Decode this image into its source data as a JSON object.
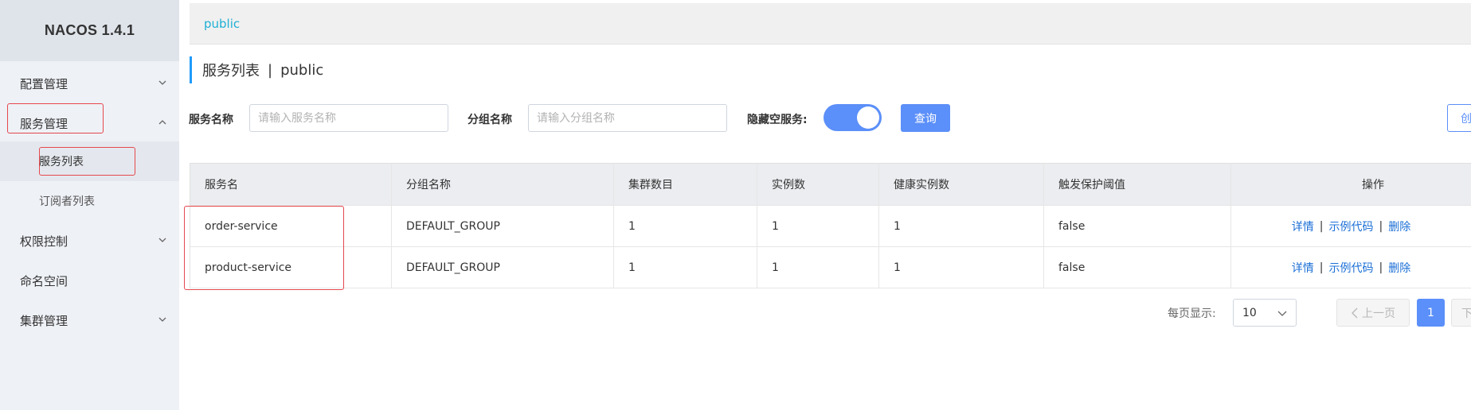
{
  "app": {
    "title": "NACOS 1.4.1"
  },
  "sidebar": {
    "items": [
      {
        "label": "配置管理",
        "icon": "chevron-down-icon"
      },
      {
        "label": "服务管理",
        "icon": "chevron-up-icon"
      },
      {
        "label": "服务列表"
      },
      {
        "label": "订阅者列表"
      },
      {
        "label": "权限控制",
        "icon": "chevron-down-icon"
      },
      {
        "label": "命名空间"
      },
      {
        "label": "集群管理",
        "icon": "chevron-down-icon"
      }
    ]
  },
  "breadcrumb": {
    "namespace": "public"
  },
  "page": {
    "title": "服务列表",
    "separator": "|",
    "namespace": "public"
  },
  "filters": {
    "service_name_label": "服务名称",
    "service_name_placeholder": "请输入服务名称",
    "group_name_label": "分组名称",
    "group_name_placeholder": "请输入分组名称",
    "hide_empty_label": "隐藏空服务:",
    "hide_empty_on": true,
    "query_label": "查询",
    "create_label": "创"
  },
  "table": {
    "headers": [
      "服务名",
      "分组名称",
      "集群数目",
      "实例数",
      "健康实例数",
      "触发保护阈值",
      "操作"
    ],
    "rows": [
      {
        "name": "order-service",
        "group": "DEFAULT_GROUP",
        "clusters": "1",
        "instances": "1",
        "healthy": "1",
        "threshold": "false"
      },
      {
        "name": "product-service",
        "group": "DEFAULT_GROUP",
        "clusters": "1",
        "instances": "1",
        "healthy": "1",
        "threshold": "false"
      }
    ],
    "actions": {
      "detail": "详情",
      "sep": "|",
      "sample_code": "示例代码",
      "delete": "删除"
    }
  },
  "pagination": {
    "page_size_label": "每页显示:",
    "page_size": "10",
    "prev_label": "上一页",
    "current_page": "1",
    "next_label": "下一"
  },
  "colors": {
    "accent": "#5b8ff9",
    "link": "#1b6fd6",
    "breadcrumb": "#1fb0d4",
    "highlight": "#e5484d"
  }
}
